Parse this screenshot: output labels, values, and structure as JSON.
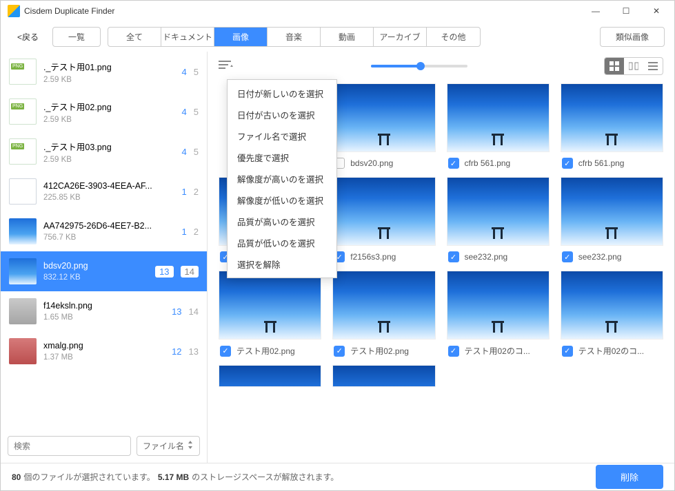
{
  "window": {
    "title": "Cisdem Duplicate Finder"
  },
  "toolbar": {
    "back": "<戻る",
    "list_btn": "一覧",
    "segments": [
      "全て",
      "ドキュメント",
      "画像",
      "音楽",
      "動画",
      "アーカイブ",
      "その他"
    ],
    "active_segment": 2,
    "similar_btn": "類似画像"
  },
  "sidebar": {
    "items": [
      {
        "name": "._テスト用01.png",
        "size": "2.59 KB",
        "sel": 4,
        "tot": 5,
        "thumb": "png"
      },
      {
        "name": "._テスト用02.png",
        "size": "2.59 KB",
        "sel": 4,
        "tot": 5,
        "thumb": "png"
      },
      {
        "name": "._テスト用03.png",
        "size": "2.59 KB",
        "sel": 4,
        "tot": 5,
        "thumb": "png"
      },
      {
        "name": "412CA26E-3903-4EEA-AF...",
        "size": "225.85 KB",
        "sel": 1,
        "tot": 2,
        "thumb": "doc"
      },
      {
        "name": "AA742975-26D6-4EE7-B2...",
        "size": "756.7 KB",
        "sel": 1,
        "tot": 2,
        "thumb": "sky"
      },
      {
        "name": "bdsv20.png",
        "size": "832.12 KB",
        "sel": 13,
        "tot": 14,
        "thumb": "sky",
        "selected": true
      },
      {
        "name": "f14eksln.png",
        "size": "1.65 MB",
        "sel": 13,
        "tot": 14,
        "thumb": "photo1"
      },
      {
        "name": "xmalg.png",
        "size": "1.37 MB",
        "sel": 12,
        "tot": 13,
        "thumb": "photo2"
      }
    ],
    "search_placeholder": "検索",
    "sort_label": "ファイル名"
  },
  "dropdown": {
    "items": [
      "日付が新しいのを選択",
      "日付が古いのを選択",
      "ファイル名で選択",
      "優先度で選択",
      "解像度が高いのを選択",
      "解像度が低いのを選択",
      "品質が高いのを選択",
      "品質が低いのを選択",
      "選択を解除"
    ]
  },
  "grid": {
    "tiles": [
      {
        "label": "bdsv20.png",
        "checked": false
      },
      {
        "label": "cfrb 561.png",
        "checked": true
      },
      {
        "label": "cfrb 561.png",
        "checked": true
      },
      {
        "label": "f2156s3.png",
        "checked": true
      },
      {
        "label": "f2156s3.png",
        "checked": true
      },
      {
        "label": "see232.png",
        "checked": true
      },
      {
        "label": "see232.png",
        "checked": true
      },
      {
        "label": "テスト用02.png",
        "checked": true
      },
      {
        "label": "テスト用02.png",
        "checked": true
      },
      {
        "label": "テスト用02のコ...",
        "checked": true
      },
      {
        "label": "テスト用02のコ...",
        "checked": true
      }
    ]
  },
  "status": {
    "count": "80",
    "text1": "個のファイルが選択されています。",
    "size": "5.17 MB",
    "text2": "のストレージスペースが解放されます。",
    "delete": "削除"
  }
}
